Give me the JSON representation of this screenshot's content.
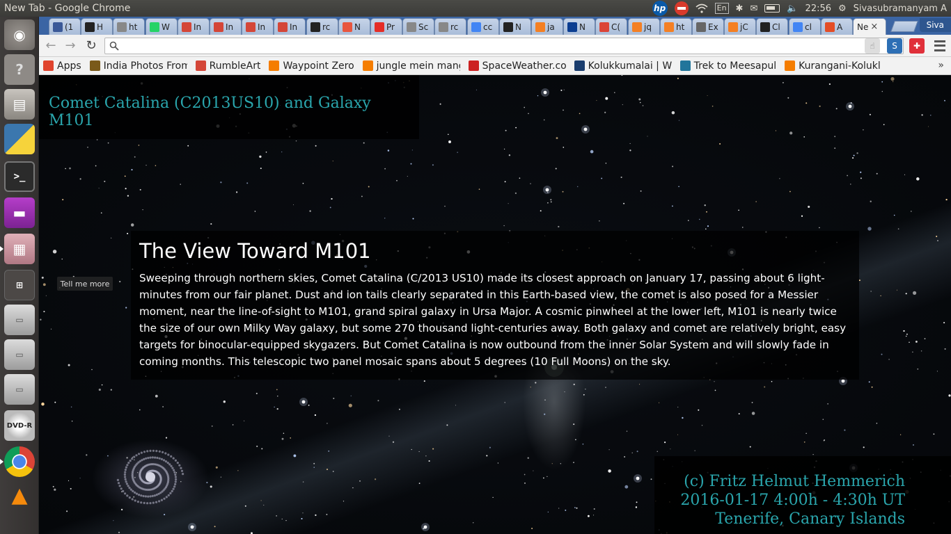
{
  "os_panel": {
    "window_title": "New Tab - Google Chrome",
    "clock": "22:56",
    "user": "Sivasubramanyam A",
    "keyboard_layout": "En"
  },
  "launcher": {
    "items": [
      "dash-home",
      "help",
      "files",
      "python",
      "terminal",
      "purple-app",
      "software-center",
      "workspace-switcher",
      "drive-1",
      "drive-2",
      "drive-3",
      "dvd-r",
      "chrome",
      "vlc"
    ]
  },
  "browser": {
    "tabs": [
      {
        "label": "(1",
        "icon": "facebook",
        "color": "#3b5998"
      },
      {
        "label": "H",
        "icon": "github",
        "color": "#222222"
      },
      {
        "label": "ht",
        "icon": "page",
        "color": "#888888"
      },
      {
        "label": "W",
        "icon": "whatsapp",
        "color": "#25d366"
      },
      {
        "label": "In",
        "icon": "gmail",
        "color": "#d44638"
      },
      {
        "label": "In",
        "icon": "gmail",
        "color": "#d44638"
      },
      {
        "label": "In",
        "icon": "gmail",
        "color": "#d44638"
      },
      {
        "label": "In",
        "icon": "gmail",
        "color": "#d44638"
      },
      {
        "label": "rc",
        "icon": "github",
        "color": "#222222"
      },
      {
        "label": "N",
        "icon": "plus",
        "color": "#e8563f"
      },
      {
        "label": "Pr",
        "icon": "youtube",
        "color": "#e52d27"
      },
      {
        "label": "Sc",
        "icon": "page",
        "color": "#888888"
      },
      {
        "label": "rc",
        "icon": "page",
        "color": "#888888"
      },
      {
        "label": "cc",
        "icon": "google",
        "color": "#4285f4"
      },
      {
        "label": "N",
        "icon": "github",
        "color": "#222222"
      },
      {
        "label": "ja",
        "icon": "stackoverflow",
        "color": "#f48024"
      },
      {
        "label": "N",
        "icon": "nasa",
        "color": "#0b3d91"
      },
      {
        "label": "C(",
        "icon": "chrome",
        "color": "#db4437"
      },
      {
        "label": "jq",
        "icon": "stackoverflow",
        "color": "#f48024"
      },
      {
        "label": "ht",
        "icon": "stackoverflow",
        "color": "#f48024"
      },
      {
        "label": "Ex",
        "icon": "puzzle",
        "color": "#666666"
      },
      {
        "label": "jC",
        "icon": "stackoverflow",
        "color": "#f48024"
      },
      {
        "label": "Cl",
        "icon": "github",
        "color": "#222222"
      },
      {
        "label": "cl",
        "icon": "google",
        "color": "#4285f4"
      },
      {
        "label": "A",
        "icon": "html5",
        "color": "#e44d26"
      },
      {
        "label": "Ne",
        "icon": "none",
        "color": "#f2f2f2",
        "active": true
      }
    ],
    "profile_name": "Siva",
    "omnibox": {
      "value": "",
      "placeholder": ""
    },
    "bookmarks": [
      {
        "label": "Apps",
        "icon": "apps-grid",
        "color": "#e0442e"
      },
      {
        "label": "India Photos From",
        "icon": "tt",
        "color": "#7a5a1a"
      },
      {
        "label": "RumbleArt",
        "icon": "gmail",
        "color": "#d44638"
      },
      {
        "label": "Waypoint Zero",
        "icon": "blogger",
        "color": "#f57d00"
      },
      {
        "label": "jungle mein mang",
        "icon": "blogger",
        "color": "#f57d00"
      },
      {
        "label": "SpaceWeather.co",
        "icon": "spaceweather",
        "color": "#cc2222"
      },
      {
        "label": "Kolukkumalai | W",
        "icon": "grid",
        "color": "#1a3d6e"
      },
      {
        "label": "Trek to Meesapul",
        "icon": "wordpress",
        "color": "#21759b"
      },
      {
        "label": "Kurangani-Kolukl",
        "icon": "blogger",
        "color": "#f57d00"
      }
    ],
    "bookmarks_more": "»"
  },
  "page": {
    "title": "Comet Catalina (C2013US10) and Galaxy M101",
    "heading": "The View Toward M101",
    "description": "Sweeping through northern skies, Comet Catalina (C/2013 US10) made its closest approach on January 17, passing about 6 light-minutes from our fair planet. Dust and ion tails clearly separated in this Earth-based view, the comet is also posed for a Messier moment, near the line-of-sight to M101, grand spiral galaxy in Ursa Major. A cosmic pinwheel at the lower left, M101 is nearly twice the size of our own Milky Way galaxy, but some 270 thousand light-centuries away. Both galaxy and comet are relatively bright, easy targets for binocular-equipped skygazers. But Comet Catalina is now outbound from the inner Solar System and will slowly fade in coming months. This telescopic two panel mosaic spans about 5 degrees (10 Full Moons) on the sky.",
    "tell_more_label": "Tell me more",
    "credit": {
      "line1": "(c) Fritz Helmut Hemmerich",
      "line2": "2016-01-17 4:00h - 4:30h UT",
      "line3": "Tenerife, Canary Islands"
    },
    "accent_color": "#2aa6ad"
  }
}
